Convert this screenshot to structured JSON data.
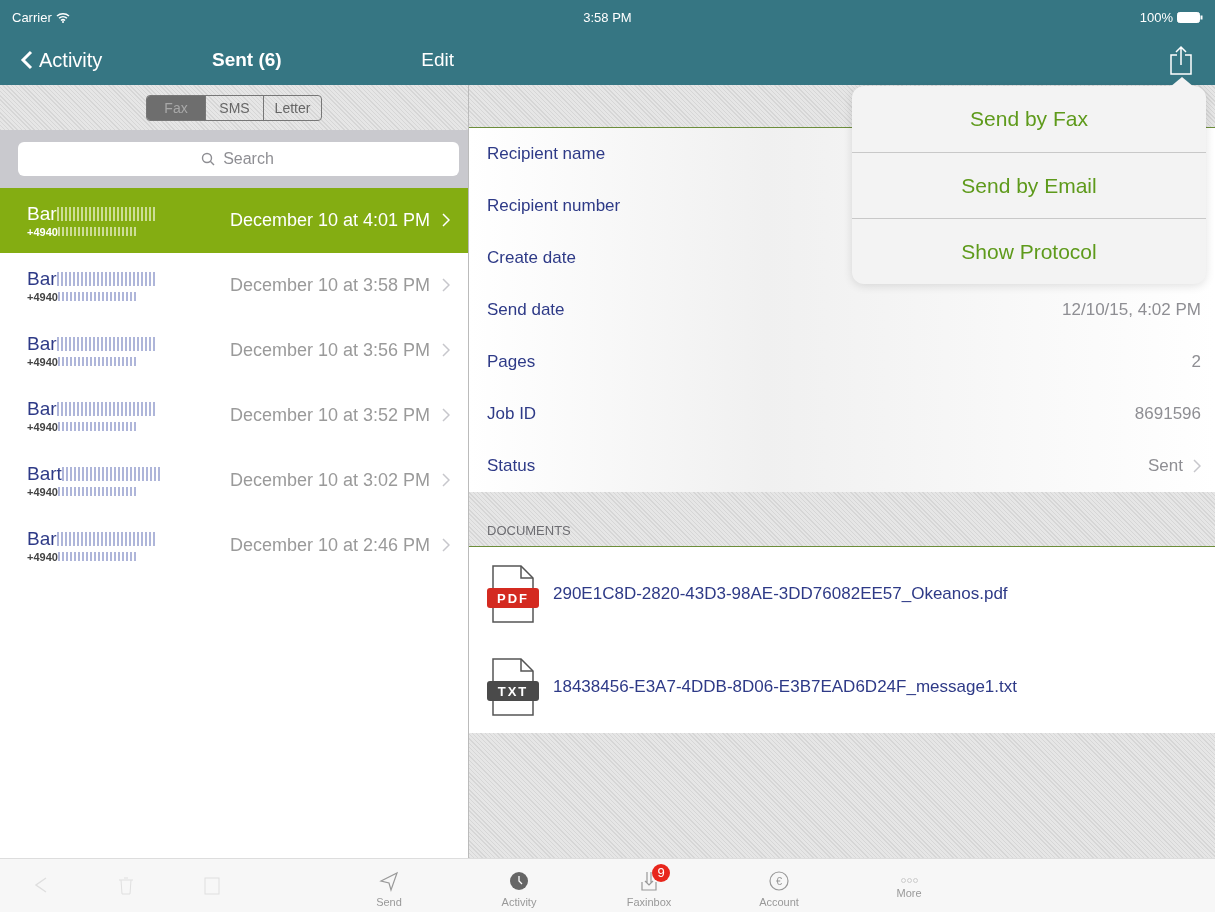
{
  "status_bar": {
    "carrier": "Carrier",
    "time": "3:58 PM",
    "battery": "100%"
  },
  "nav": {
    "back": "Activity",
    "title": "Sent (6)",
    "edit": "Edit"
  },
  "segments": [
    {
      "label": "Fax",
      "selected": true
    },
    {
      "label": "SMS",
      "selected": false
    },
    {
      "label": "Letter",
      "selected": false
    }
  ],
  "search": {
    "placeholder": "Search"
  },
  "messages": [
    {
      "name": "Bar",
      "number": "+4940",
      "date": "December 10 at 4:01 PM",
      "selected": true
    },
    {
      "name": "Bar",
      "number": "+4940",
      "date": "December 10 at 3:58 PM",
      "selected": false
    },
    {
      "name": "Bar",
      "number": "+4940",
      "date": "December 10 at 3:56 PM",
      "selected": false
    },
    {
      "name": "Bar",
      "number": "+4940",
      "date": "December 10 at 3:52 PM",
      "selected": false
    },
    {
      "name": "Bart",
      "number": "+4940",
      "date": "December 10 at 3:02 PM",
      "selected": false
    },
    {
      "name": "Bar",
      "number": "+4940",
      "date": "December 10 at 2:46 PM",
      "selected": false
    }
  ],
  "details": [
    {
      "label": "Recipient name",
      "kind": "hidden"
    },
    {
      "label": "Recipient number",
      "kind": "hidden"
    },
    {
      "label": "Create date",
      "kind": "hidden"
    },
    {
      "label": "Send date",
      "value": "12/10/15, 4:02 PM",
      "kind": "value"
    },
    {
      "label": "Pages",
      "value": "2",
      "kind": "value"
    },
    {
      "label": "Job ID",
      "value": "8691596",
      "kind": "value"
    },
    {
      "label": "Status",
      "value": "Sent",
      "kind": "disclosure"
    }
  ],
  "documents": {
    "header": "DOCUMENTS",
    "files": [
      {
        "type": "PDF",
        "color": "#d42a20",
        "name": "290E1C8D-2820-43D3-98AE-3DD76082EE57_Okeanos.pdf"
      },
      {
        "type": "TXT",
        "color": "#4a4a4a",
        "name": "18438456-E3A7-4DDB-8D06-E3B7EAD6D24F_message1.txt"
      }
    ]
  },
  "popover": {
    "items": [
      "Send by Fax",
      "Send by Email",
      "Show Protocol"
    ]
  },
  "tab_bar": [
    {
      "kind": "send",
      "label": "Send",
      "selected": false
    },
    {
      "kind": "activity",
      "label": "Activity",
      "selected": true
    },
    {
      "kind": "inbox",
      "label": "Faxinbox",
      "badge": "9",
      "selected": false
    },
    {
      "kind": "account",
      "label": "Account",
      "symbol": "€",
      "selected": false
    },
    {
      "kind": "more",
      "label": "More",
      "selected": false
    }
  ]
}
